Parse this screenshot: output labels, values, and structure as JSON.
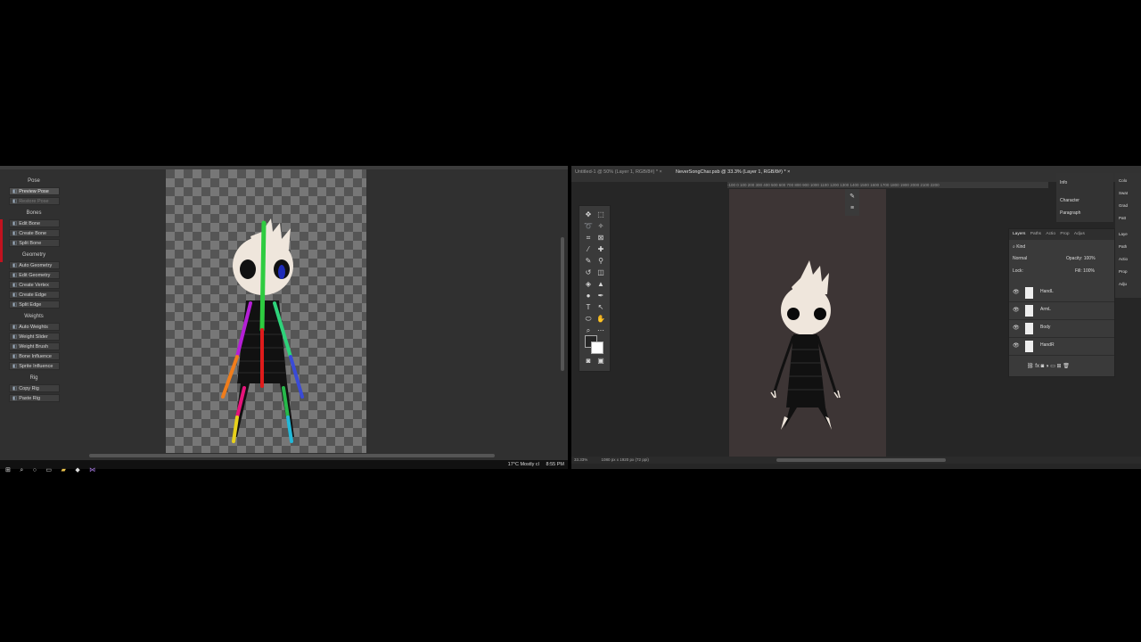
{
  "unity": {
    "sections": [
      {
        "title": "Pose",
        "buttons": [
          {
            "label": "Preview Pose",
            "state": "active"
          },
          {
            "label": "Restore Pose",
            "state": "dim"
          }
        ]
      },
      {
        "title": "Bones",
        "buttons": [
          {
            "label": "Edit Bone"
          },
          {
            "label": "Create Bone"
          },
          {
            "label": "Split Bone"
          }
        ]
      },
      {
        "title": "Geometry",
        "buttons": [
          {
            "label": "Auto Geometry"
          },
          {
            "label": "Edit Geometry"
          },
          {
            "label": "Create Vertex"
          },
          {
            "label": "Create Edge"
          },
          {
            "label": "Split Edge"
          }
        ]
      },
      {
        "title": "Weights",
        "buttons": [
          {
            "label": "Auto Weights"
          },
          {
            "label": "Weight Slider"
          },
          {
            "label": "Weight Brush"
          },
          {
            "label": "Bone Influence"
          },
          {
            "label": "Sprite Influence"
          }
        ]
      },
      {
        "title": "Rig",
        "buttons": [
          {
            "label": "Copy Rig"
          },
          {
            "label": "Paste Rig"
          }
        ]
      }
    ]
  },
  "taskbar": {
    "weather": "17°C  Mostly cl",
    "time": "8:55 PM"
  },
  "photoshop": {
    "tabs": [
      {
        "label": "Untitled-1 @ 50% (Layer 1, RGB/8#) *  ×"
      },
      {
        "label": "NeverSongChar.psb @ 33.3% (Layer 1, RGB/8#) *  ×"
      }
    ],
    "ruler": "-100  0  100  200  300  400  500  600  700  800  900  1000  1100  1200  1300  1400  1500  1600  1700  1800  1900  2000  2100  2200",
    "layers_panel": {
      "tabs": [
        "Layers",
        "Paths",
        "Actio",
        "Prop",
        "Adjus"
      ],
      "kind_label": "Kind",
      "blend_mode": "Normal",
      "opacity_label": "Opacity:",
      "opacity_value": "100%",
      "lock_label": "Lock:",
      "fill_label": "Fill:",
      "fill_value": "100%",
      "layers": [
        {
          "name": "HandL"
        },
        {
          "name": "ArmL"
        },
        {
          "name": "Body"
        },
        {
          "name": "HandR"
        }
      ]
    },
    "mini_panel": [
      "Info",
      "Character",
      "Paragraph"
    ],
    "right_column": [
      "Colo",
      "Swat",
      "Grad",
      "Patt",
      "Laye",
      "Path",
      "Actio",
      "Prop",
      "Adju"
    ],
    "status": {
      "zoom": "33.33%",
      "doc_info": "1080 px x 1920 px (72 ppi)"
    }
  }
}
